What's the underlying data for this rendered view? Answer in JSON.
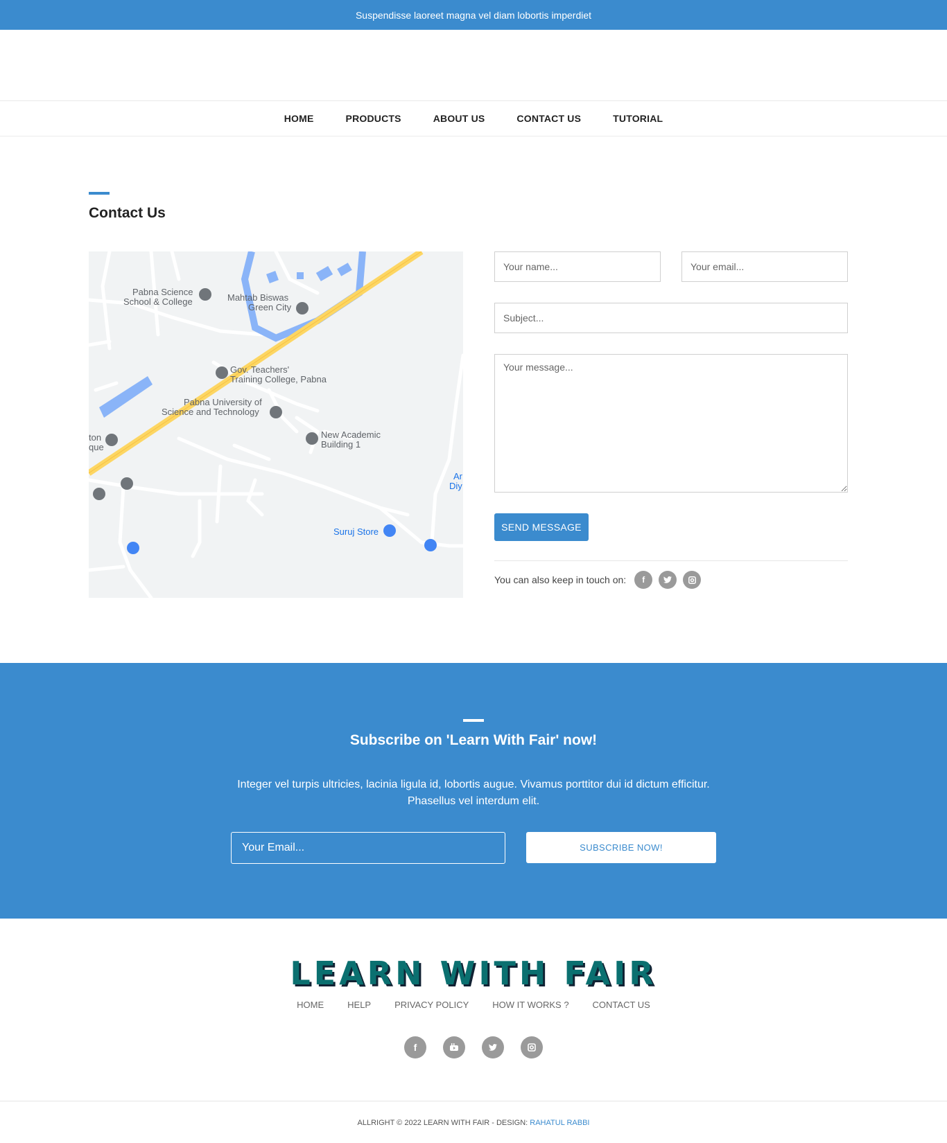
{
  "topbar": {
    "text": "Suspendisse laoreet magna vel diam lobortis imperdiet"
  },
  "nav": {
    "items": [
      "HOME",
      "PRODUCTS",
      "ABOUT US",
      "CONTACT US",
      "TUTORIAL"
    ]
  },
  "contact": {
    "title": "Contact Us",
    "map_labels": {
      "pabna_science": "Pabna Science",
      "school_college": "School & College",
      "mahtab_biswas": "Mahtab Biswas",
      "green_city": "Green City",
      "gov_teachers": "Gov. Teachers'",
      "training_college": "Training College, Pabna",
      "pabna_university": "Pabna University of",
      "science_technology": "Science and Technology",
      "new_academic": "New Academic",
      "building_1": "Building 1",
      "suruj_store": "Suruj Store",
      "ton": "ton",
      "que": "que",
      "ar": "Ar",
      "diy": "Diy"
    },
    "form": {
      "name_placeholder": "Your name...",
      "email_placeholder": "Your email...",
      "subject_placeholder": "Subject...",
      "message_placeholder": "Your message...",
      "send_label": "SEND MESSAGE"
    },
    "touch_text": "You can also keep in touch on:",
    "social_icons": [
      "facebook-icon",
      "twitter-icon",
      "instagram-icon"
    ]
  },
  "subscribe": {
    "title": "Subscribe on 'Learn With Fair' now!",
    "text": "Integer vel turpis ultricies, lacinia ligula id, lobortis augue. Vivamus porttitor dui id dictum efficitur. Phasellus vel interdum elit.",
    "email_placeholder": "Your Email...",
    "button_label": "SUBSCRIBE NOW!"
  },
  "footer": {
    "logo": "LEARN WITH FAIR",
    "links": [
      "HOME",
      "HELP",
      "PRIVACY POLICY",
      "HOW IT WORKS ?",
      "CONTACT US"
    ],
    "social_icons": [
      "facebook-icon",
      "youtube-icon",
      "twitter-icon",
      "instagram-icon"
    ],
    "copyright": "ALLRIGHT © 2022 LEARN WITH FAIR - DESIGN: ",
    "designer": "RAHATUL RABBI"
  },
  "colors": {
    "accent": "#3b8bce",
    "logo": "#0b7070",
    "icon_grey": "#9a9a9a"
  }
}
